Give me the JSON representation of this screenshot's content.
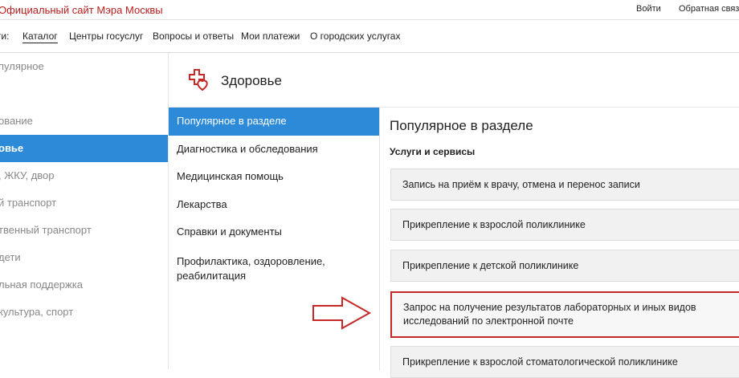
{
  "header": {
    "site_title": "Официальный сайт Мэра Москвы",
    "login": "Войти",
    "feedback": "Обратная связь"
  },
  "menu": {
    "prefix": "ги:",
    "items": [
      {
        "label": "Каталог"
      },
      {
        "label": "Центры госуслуг"
      },
      {
        "label": "Вопросы и ответы"
      },
      {
        "label": "Мои платежи"
      },
      {
        "label": "О городских услугах"
      }
    ]
  },
  "leftnav": {
    "items": [
      {
        "label": "пулярное"
      },
      {
        "label": ""
      },
      {
        "label": "ование"
      },
      {
        "label": "овье"
      },
      {
        "label": ", ЖКУ, двор"
      },
      {
        "label": "й транспорт"
      },
      {
        "label": "твенный транспорт"
      },
      {
        "label": "дети"
      },
      {
        "label": "льная поддержка"
      },
      {
        "label": "культура, спорт"
      },
      {
        "label": ""
      }
    ]
  },
  "section": {
    "title": "Здоровье",
    "icon": "health-cross-heart-icon",
    "accent": "#c62828"
  },
  "subnav": {
    "items": [
      {
        "label": "Популярное в разделе"
      },
      {
        "label": "Диагностика и обследования"
      },
      {
        "label": "Медицинская помощь"
      },
      {
        "label": "Лекарства"
      },
      {
        "label": "Справки и документы"
      },
      {
        "label": "Профилактика, оздоровление, реабилитация"
      }
    ]
  },
  "content": {
    "title": "Популярное в разделе",
    "subtitle": "Услуги и сервисы",
    "services": [
      {
        "label": "Запись на приём к врачу, отмена и перенос записи"
      },
      {
        "label": "Прикрепление к взрослой поликлинике"
      },
      {
        "label": "Прикрепление к детской поликлинике"
      },
      {
        "label": "Запрос на получение результатов лабораторных и иных видов исследований по электронной почте"
      },
      {
        "label": "Прикрепление к взрослой стоматологической поликлинике"
      }
    ]
  },
  "colors": {
    "active_blue": "#2c8ad8",
    "highlight_red": "#c62828"
  }
}
